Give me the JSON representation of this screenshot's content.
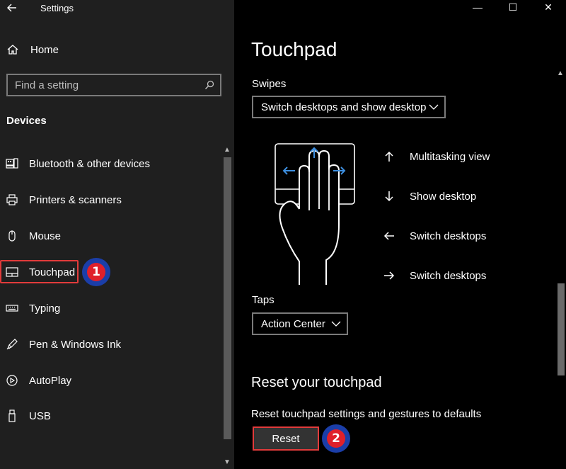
{
  "window": {
    "title": "Settings",
    "controls": {
      "minimize": "—",
      "maximize": "☐",
      "close": "✕"
    }
  },
  "sidebar": {
    "home_label": "Home",
    "search_placeholder": "Find a setting",
    "section": "Devices",
    "items": [
      {
        "label": "Bluetooth & other devices",
        "icon": "bluetooth-devices-icon"
      },
      {
        "label": "Printers & scanners",
        "icon": "printer-icon"
      },
      {
        "label": "Mouse",
        "icon": "mouse-icon"
      },
      {
        "label": "Touchpad",
        "icon": "touchpad-icon",
        "selected": true
      },
      {
        "label": "Typing",
        "icon": "keyboard-icon"
      },
      {
        "label": "Pen & Windows Ink",
        "icon": "pen-icon"
      },
      {
        "label": "AutoPlay",
        "icon": "autoplay-icon"
      },
      {
        "label": "USB",
        "icon": "usb-icon"
      }
    ]
  },
  "annotations": {
    "badge1": "1",
    "badge2": "2"
  },
  "main": {
    "title": "Touchpad",
    "swipes": {
      "label": "Swipes",
      "value": "Switch desktops and show desktop"
    },
    "legend": [
      {
        "arrow": "up",
        "text": "Multitasking view"
      },
      {
        "arrow": "down",
        "text": "Show desktop"
      },
      {
        "arrow": "left",
        "text": "Switch desktops"
      },
      {
        "arrow": "right",
        "text": "Switch desktops"
      }
    ],
    "taps": {
      "label": "Taps",
      "value": "Action Center"
    },
    "reset": {
      "heading": "Reset your touchpad",
      "description": "Reset touchpad settings and gestures to defaults",
      "button": "Reset"
    }
  },
  "colors": {
    "sidebar_bg": "#1f1f1f",
    "main_bg": "#000000",
    "highlight_border": "#e23b3b",
    "gesture_arrow": "#3d8fe0",
    "badge_outer": "#1b3ea8",
    "badge_inner": "#e0202a"
  }
}
